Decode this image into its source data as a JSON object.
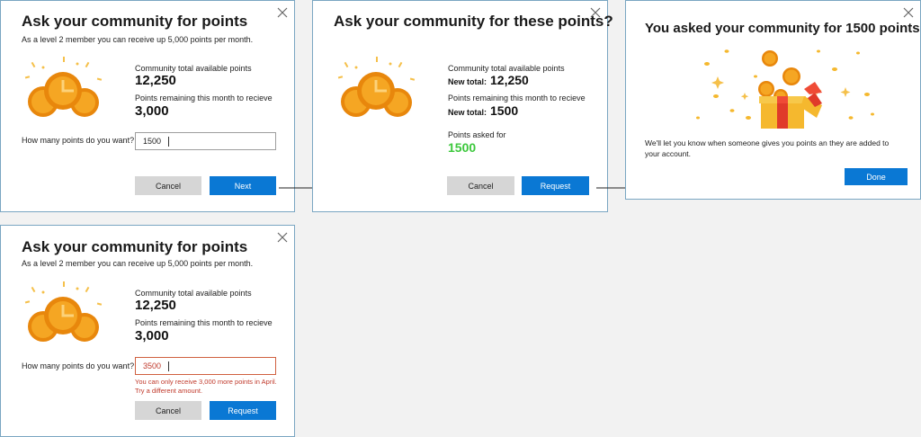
{
  "dialog_ask": {
    "title": "Ask your community for points",
    "subtitle": "As a level 2 member you can receive up 5,000 points per month.",
    "total_label": "Community total available points",
    "total_value": "12,250",
    "remaining_label": "Points remaining this month to recieve",
    "remaining_value": "3,000",
    "input_label": "How many points do you want?",
    "input_value": "1500",
    "cancel_label": "Cancel",
    "next_label": "Next"
  },
  "dialog_confirm": {
    "title": "Ask your community for these points?",
    "total_label": "Community total available points",
    "total_prefix": "New total:",
    "total_value": "12,250",
    "remaining_label": "Points remaining this month to recieve",
    "remaining_prefix": "New total:",
    "remaining_value": "1500",
    "asked_label": "Points asked for",
    "asked_value": "1500",
    "cancel_label": "Cancel",
    "request_label": "Request"
  },
  "dialog_done": {
    "title": "You asked your community for 1500 points",
    "message": "We'll let you know when someone gives you points an they are added to your account.",
    "done_label": "Done"
  },
  "dialog_error": {
    "title": "Ask your community for points",
    "subtitle": "As a level 2 member you can receive up 5,000 points per month.",
    "total_label": "Community total available points",
    "total_value": "12,250",
    "remaining_label": "Points remaining this month to recieve",
    "remaining_value": "3,000",
    "input_label": "How many points do you want?",
    "input_value": "3500",
    "error_message": "You can only receive 3,000 more points in April. Try a different amount.",
    "cancel_label": "Cancel",
    "request_label": "Request"
  },
  "colors": {
    "primary": "#0a78d4",
    "secondary": "#d6d6d6",
    "coin": "#f5a623",
    "coin_dark": "#e8870c",
    "success": "#3cc83c",
    "error": "#c0392b",
    "dialog_border": "#7aa6c2"
  },
  "icons": {
    "close": "close-icon",
    "coins": "coins-icon",
    "gift": "gift-box-icon",
    "arrow": "arrow-right-icon"
  }
}
